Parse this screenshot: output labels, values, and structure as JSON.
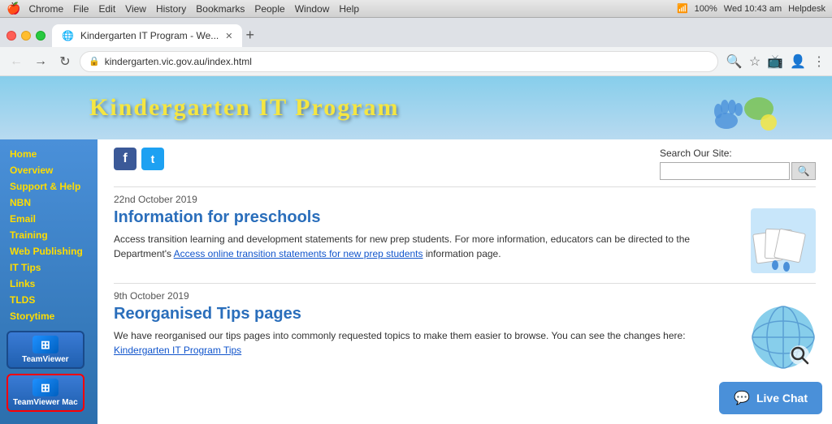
{
  "mac_bar": {
    "apple": "🍎",
    "app_name": "Chrome",
    "menus": [
      "File",
      "Edit",
      "View",
      "History",
      "Bookmarks",
      "People",
      "Window",
      "Help"
    ],
    "time": "Wed 10:43 am",
    "helpdesk": "Helpdesk",
    "battery": "100%"
  },
  "browser": {
    "tab_title": "Kindergarten IT Program - We...",
    "url": "kindergarten.vic.gov.au/index.html",
    "new_tab_label": "+"
  },
  "sidebar": {
    "items": [
      {
        "label": "Home",
        "active": false
      },
      {
        "label": "Overview",
        "active": false
      },
      {
        "label": "Support & Help",
        "active": false
      },
      {
        "label": "NBN",
        "active": false
      },
      {
        "label": "Email",
        "active": false
      },
      {
        "label": "Training",
        "active": false
      },
      {
        "label": "Web Publishing",
        "active": false
      },
      {
        "label": "IT Tips",
        "active": false
      },
      {
        "label": "Links",
        "active": false
      },
      {
        "label": "TLDS",
        "active": false
      },
      {
        "label": "Storytime",
        "active": false
      }
    ],
    "teamviewer_label": "TeamViewer",
    "teamviewer_mac_label": "TeamViewer Mac"
  },
  "site": {
    "title": "Kindergarten IT Program",
    "search_label": "Search Our Site:",
    "search_placeholder": "",
    "search_btn_label": "q"
  },
  "articles": [
    {
      "date": "22nd October 2019",
      "title": "Information for preschools",
      "body": "Access transition learning and development statements for new prep students. For more information, educators can be directed to the Department's",
      "link_text": "Access online transition statements for new prep students",
      "body_end": "information page.",
      "image_type": "folders"
    },
    {
      "date": "9th October 2019",
      "title": "Reorganised Tips pages",
      "body": "We have reorganised our tips pages into commonly requested topics to make them easier to browse. You can see the changes here:",
      "link_text": "Kindergarten IT Program Tips",
      "body_end": "",
      "image_type": "globe"
    }
  ],
  "live_chat": {
    "label": "Live Chat",
    "icon": "💬"
  },
  "social": {
    "facebook_label": "f",
    "twitter_label": "t"
  }
}
